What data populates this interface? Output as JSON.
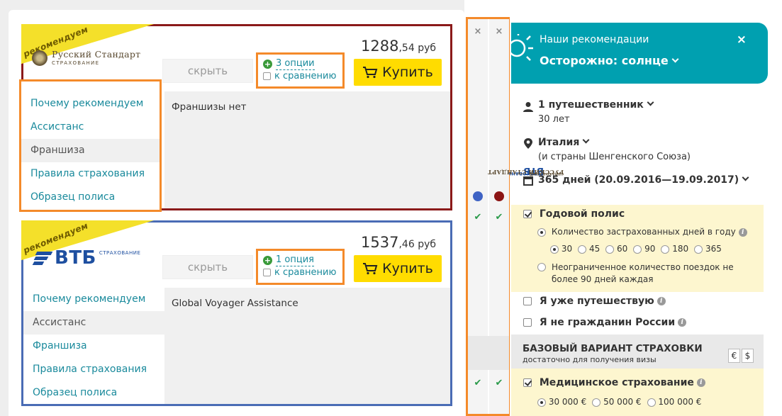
{
  "offers": [
    {
      "badge": "рекомендуем",
      "logo_name": "Русский Стандарт",
      "logo_sub": "СТРАХОВАНИЕ",
      "border_color": "#8b1a1a",
      "hide_label": "скрыть",
      "options_label": "3 опции",
      "compare_label": "к сравнению",
      "price_main": "1288",
      "price_cents": ",54",
      "currency": "руб",
      "buy_label": "Купить",
      "menu": [
        "Почему рекомендуем",
        "Ассистанс",
        "Франшиза",
        "Правила страхования",
        "Образец полиса"
      ],
      "active_menu": "Франшиза",
      "content": "Франшизы нет"
    },
    {
      "badge": "рекомендуем",
      "logo_name": "ВТБ",
      "logo_sub": "СТРАХОВАНИЕ",
      "border_color": "#4a6cb5",
      "hide_label": "скрыть",
      "options_label": "1 опция",
      "compare_label": "к сравнению",
      "price_main": "1537",
      "price_cents": ",46",
      "currency": "руб",
      "buy_label": "Купить",
      "menu": [
        "Почему рекомендуем",
        "Ассистанс",
        "Франшиза",
        "Правила страхования",
        "Образец полиса"
      ],
      "active_menu": "Ассистанс",
      "content": "Global Voyager Assistance"
    }
  ],
  "compare": {
    "close_symbol": "×",
    "columns": [
      {
        "name": "ВТБ",
        "sub": "СТРАХОВАНИЕ",
        "dot_color": "#3f63c4"
      },
      {
        "name": "РУССКИЙ СТАНДАРТ",
        "sub": "СТРАХОВАНИЕ",
        "dot_color": "#8b1414"
      }
    ]
  },
  "recommendations": {
    "title": "Наши рекомендации",
    "main": "Осторожно: солнце",
    "close_symbol": "×"
  },
  "filters": {
    "travelers": "1 путешественник",
    "age": "30 лет",
    "country": "Италия",
    "country_note": "(и страны Шенгенского Союза)",
    "period": "365 дней (20.09.2016—19.09.2017)",
    "annual_label": "Годовой полис",
    "days_label": "Количество застрахованных дней в году",
    "days_options": [
      "30",
      "45",
      "60",
      "90",
      "180",
      "365"
    ],
    "days_selected": "30",
    "unlimited_label": "Неограниченное количество поездок не более 90 дней каждая",
    "traveling_label": "Я уже путешествую",
    "not_citizen_label": "Я не гражданин России",
    "base_title": "БАЗОВЫЙ ВАРИАНТ СТРАХОВКИ",
    "base_sub": "достаточно для получения визы",
    "currency_euro": "€",
    "currency_usd": "$",
    "medical_label": "Медицинское страхование",
    "medical_options": [
      "30 000 €",
      "50 000 €",
      "100 000 €"
    ],
    "medical_selected": "30 000 €"
  },
  "colors": {
    "accent_teal": "#00a0b0",
    "buy_yellow": "#ffdc00",
    "highlight_orange": "#f48a2a",
    "check_green": "#2a9a4a"
  }
}
